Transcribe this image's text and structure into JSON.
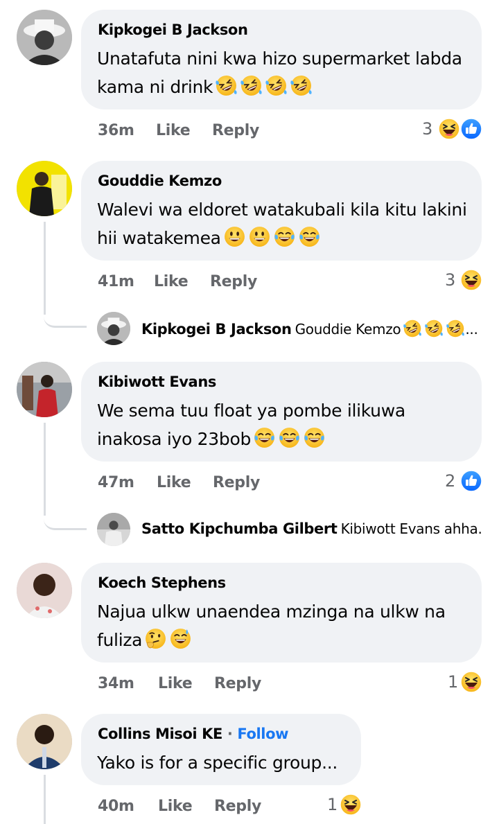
{
  "comments": [
    {
      "author": "Kipkogei B Jackson",
      "text": "Unatafuta nini kwa hizo supermarket labda kama ni drink",
      "time": "36m",
      "like": "Like",
      "reply": "Reply",
      "reaction_count": "3",
      "reactions": [
        "haha-icon",
        "like-icon"
      ],
      "emojis": [
        "rofl-emoji",
        "rofl-emoji",
        "rofl-emoji",
        "rofl-emoji"
      ]
    },
    {
      "author": "Gouddie Kemzo",
      "text": "Walevi wa eldoret watakubali kila kitu lakini hii watakemea",
      "time": "41m",
      "like": "Like",
      "reply": "Reply",
      "reaction_count": "3",
      "reactions": [
        "haha-icon"
      ],
      "emojis": [
        "grinning-emoji",
        "grinning-emoji",
        "joy-emoji",
        "joy-emoji"
      ],
      "reply_preview": {
        "author": "Kipkogei B Jackson",
        "text": "Gouddie Kemzo",
        "ellipsis": "..."
      }
    },
    {
      "author": "Kibiwott Evans",
      "text_line1": "We sema tuu float ya pombe ilikuwa",
      "text_line2": "inakosa iyo 23bob",
      "time": "47m",
      "like": "Like",
      "reply": "Reply",
      "reaction_count": "2",
      "reactions": [
        "like-icon"
      ],
      "emojis": [
        "joy-emoji",
        "joy-emoji",
        "joy-emoji"
      ],
      "reply_preview": {
        "author": "Satto Kipchumba Gilbert",
        "text": "Kibiwott Evans ahha..."
      }
    },
    {
      "author": "Koech Stephens",
      "text_line1": "Najua ulkw unaendea mzinga na ulkw na",
      "text_line2": "fuliza",
      "time": "34m",
      "like": "Like",
      "reply": "Reply",
      "reaction_count": "1",
      "reactions": [
        "haha-icon"
      ],
      "emojis": [
        "thinking-emoji",
        "sweat-smile-emoji"
      ]
    },
    {
      "author": "Collins Misoi KE",
      "separator": "·",
      "follow": "Follow",
      "text": "Yako is for a specific group...",
      "time": "40m",
      "like": "Like",
      "reply": "Reply",
      "reaction_count": "1",
      "reactions": [
        "haha-icon"
      ]
    }
  ],
  "colors": {
    "bubble": "#f0f2f5",
    "meta": "#65676b",
    "follow": "#1877f2",
    "like_blue": "#1877f2",
    "emoji_yellow": "#ffd44a"
  }
}
